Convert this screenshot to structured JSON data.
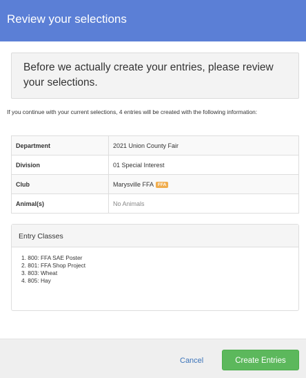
{
  "header": {
    "title": "Review your selections"
  },
  "notice": {
    "text": "Before we actually create your entries, please review your selections."
  },
  "intro": {
    "text": "If you continue with your current selections, 4 entries will be created with the following information:"
  },
  "summary": {
    "rows": [
      {
        "label": "Department",
        "value": "2021 Union County Fair"
      },
      {
        "label": "Division",
        "value": "01 Special Interest"
      },
      {
        "label": "Club",
        "value": "Marysville FFA",
        "badge": "FFA"
      },
      {
        "label": "Animal(s)",
        "value": "No Animals"
      }
    ]
  },
  "entry_classes": {
    "title": "Entry Classes",
    "items": [
      "1. 800: FFA SAE Poster",
      "2. 801: FFA Shop Project",
      "3. 803: Wheat",
      "4. 805: Hay"
    ]
  },
  "footer": {
    "cancel_label": "Cancel",
    "create_label": "Create Entries"
  },
  "colors": {
    "header": "#5b7fd6",
    "primary": "#5cb85c",
    "badge": "#f0ad4e",
    "link": "#3b73b9"
  }
}
